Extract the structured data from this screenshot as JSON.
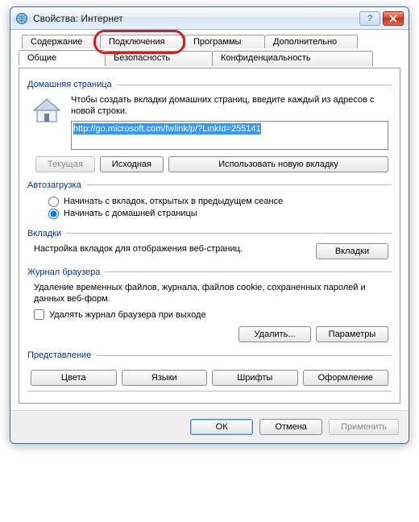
{
  "window": {
    "title": "Свойства: Интернет"
  },
  "tabs_back": {
    "t0": "Содержание",
    "t1": "Подключения",
    "t2": "Программы",
    "t3": "Дополнительно"
  },
  "tabs_front": {
    "t0": "Общие",
    "t1": "Безопасность",
    "t2": "Конфиденциальность"
  },
  "home": {
    "group": "Домашняя страница",
    "desc": "Чтобы создать вкладки домашних страниц, введите каждый из адресов с новой строки.",
    "url": "http://go.microsoft.com/fwlink/p/?LinkId=255141",
    "btn_current": "Текущая",
    "btn_default": "Исходная",
    "btn_newtab": "Использовать новую вкладку"
  },
  "startup": {
    "group": "Автозагрузка",
    "opt_last": "Начинать с вкладок, открытых в предыдущем сеансе",
    "opt_home": "Начинать с домашней страницы"
  },
  "tabsg": {
    "group": "Вкладки",
    "desc": "Настройка вкладок для отображения веб-страниц.",
    "btn": "Вкладки"
  },
  "history": {
    "group": "Журнал браузера",
    "desc": "Удаление временных файлов, журнала, файлов cookie, сохраненных паролей и данных веб-форм.",
    "chk": "Удалять журнал браузера при выходе",
    "btn_delete": "Удалить...",
    "btn_settings": "Параметры"
  },
  "appearance": {
    "group": "Представление",
    "btn_colors": "Цвета",
    "btn_lang": "Языки",
    "btn_fonts": "Шрифты",
    "btn_access": "Оформление"
  },
  "footer": {
    "ok": "ОК",
    "cancel": "Отмена",
    "apply": "Применить"
  }
}
